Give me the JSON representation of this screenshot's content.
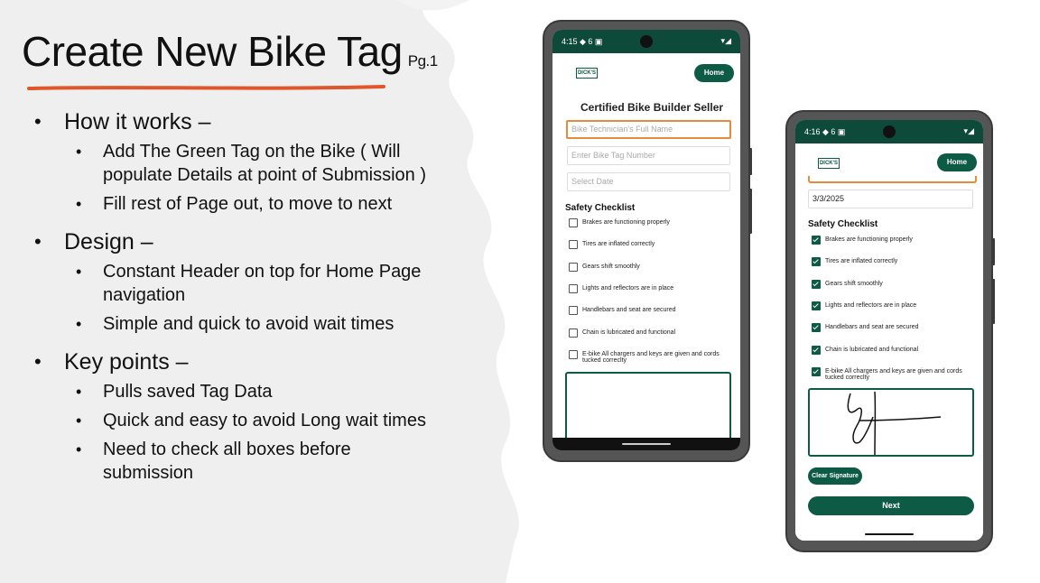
{
  "slide": {
    "title": "Create New Bike Tag",
    "page": "Pg.1",
    "accent_color": "#e0562a",
    "sections": [
      {
        "heading": "How it works  –",
        "items": [
          "Add The Green Tag on the Bike ( Will populate Details at point of Submission )",
          "Fill rest of Page out, to move to next"
        ]
      },
      {
        "heading": "Design –",
        "items": [
          "Constant Header on top for Home Page navigation",
          "Simple and quick to avoid wait times"
        ]
      },
      {
        "heading": "Key points –",
        "items": [
          "Pulls saved Tag Data",
          "Quick and easy to avoid Long wait times",
          "Need to check all boxes before submission"
        ]
      }
    ]
  },
  "phone1": {
    "time": "4:15",
    "status_icons": "◆ 6 ▣",
    "signal": "▾◢",
    "logo": "DICK'S",
    "home_label": "Home",
    "header": "Certified Bike Builder Seller",
    "name_placeholder": "Bike Technician's Full Name",
    "tag_placeholder": "Enter Bike Tag Number",
    "date_placeholder": "Select Date",
    "checklist_title": "Safety Checklist",
    "checklist": [
      {
        "label": "Brakes are functioning properly",
        "checked": false
      },
      {
        "label": "Tires are inflated correctly",
        "checked": false
      },
      {
        "label": "Gears shift smoothly",
        "checked": false
      },
      {
        "label": "Lights and reflectors are in place",
        "checked": false
      },
      {
        "label": "Handlebars and seat are secured",
        "checked": false
      },
      {
        "label": "Chain is lubricated and functional",
        "checked": false
      },
      {
        "label": "E-bike All chargers and keys are given and cords tucked correclty",
        "checked": false
      }
    ]
  },
  "phone2": {
    "time": "4:16",
    "status_icons": "◆ 6 ▣",
    "signal": "▾◢",
    "logo": "DICK'S",
    "home_label": "Home",
    "date_value": "3/3/2025",
    "checklist_title": "Safety Checklist",
    "checklist": [
      {
        "label": "Brakes are functioning properly",
        "checked": true
      },
      {
        "label": "Tires are inflated correctly",
        "checked": true
      },
      {
        "label": "Gears shift smoothly",
        "checked": true
      },
      {
        "label": "Lights and reflectors are in place",
        "checked": true
      },
      {
        "label": "Handlebars and seat are secured",
        "checked": true
      },
      {
        "label": "Chain is lubricated and functional",
        "checked": true
      },
      {
        "label": "E-bike All chargers and keys are given and cords tucked correclty",
        "checked": true
      }
    ],
    "clear_label": "Clear Signature",
    "next_label": "Next"
  },
  "colors": {
    "brand_green": "#0d5a45",
    "status_bar": "#0d4a3a",
    "focus_orange": "#e58b3a"
  }
}
